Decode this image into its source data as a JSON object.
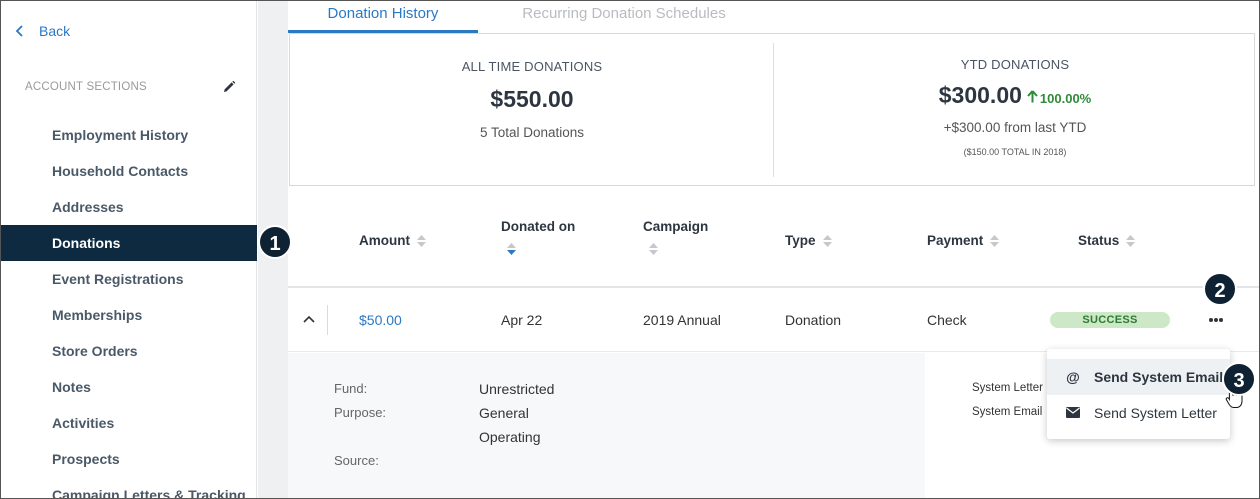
{
  "sidebar": {
    "back_label": "Back",
    "section_label": "ACCOUNT SECTIONS",
    "items": [
      {
        "label": "Employment History"
      },
      {
        "label": "Household Contacts"
      },
      {
        "label": "Addresses"
      },
      {
        "label": "Donations",
        "active": true
      },
      {
        "label": "Event Registrations"
      },
      {
        "label": "Memberships"
      },
      {
        "label": "Store Orders"
      },
      {
        "label": "Notes"
      },
      {
        "label": "Activities"
      },
      {
        "label": "Prospects"
      },
      {
        "label": "Campaign Letters & Tracking"
      }
    ]
  },
  "tabs": [
    {
      "label": "Donation History",
      "active": true
    },
    {
      "label": "Recurring Donation Schedules",
      "active": false
    }
  ],
  "summary": {
    "all_time": {
      "label": "ALL TIME DONATIONS",
      "amount": "$550.00",
      "count": "5 Total Donations"
    },
    "ytd": {
      "label": "YTD DONATIONS",
      "amount": "$300.00",
      "change_pct": "100.00%",
      "change_text": "+$300.00 from last YTD",
      "previous": "($150.00 TOTAL IN 2018)"
    }
  },
  "table": {
    "headers": {
      "amount": "Amount",
      "donated_on": "Donated on",
      "campaign": "Campaign",
      "type": "Type",
      "payment": "Payment",
      "status": "Status"
    },
    "row": {
      "amount": "$50.00",
      "donated_on": "Apr 22",
      "campaign": "2019 Annual",
      "type": "Donation",
      "payment": "Check",
      "status": "SUCCESS"
    },
    "details": {
      "fund_label": "Fund:",
      "fund_value": "Unrestricted",
      "purpose_label": "Purpose:",
      "purpose_value_1": "General",
      "purpose_value_2": "Operating",
      "source_label": "Source:",
      "system_letter_label": "System Letter",
      "system_email_label": "System Email"
    }
  },
  "menu": {
    "items": [
      {
        "label": "Send System Email",
        "icon": "at-icon"
      },
      {
        "label": "Send System Letter",
        "icon": "envelope-icon"
      }
    ]
  },
  "callouts": [
    "1",
    "2",
    "3"
  ],
  "colors": {
    "accent": "#2b78c5",
    "nav_active_bg": "#0d2a40",
    "success_bg": "#cde8c6",
    "success_text": "#2d7a32",
    "positive": "#2e8b3a"
  }
}
